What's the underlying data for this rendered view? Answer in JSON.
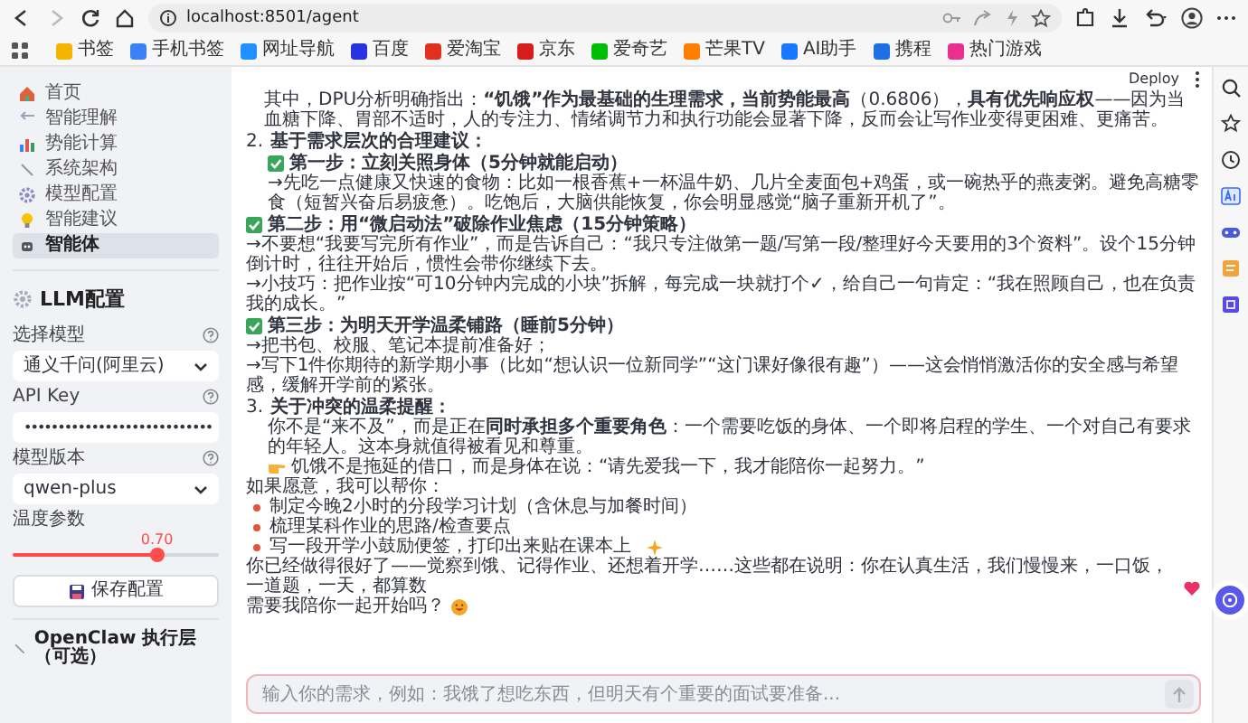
{
  "browser": {
    "url": "localhost:8501/agent",
    "bookmarks": [
      {
        "label": "书签",
        "color": "#f5b400"
      },
      {
        "label": "手机书签",
        "color": "#3b82f6"
      },
      {
        "label": "网址导航",
        "color": "#1e90ff"
      },
      {
        "label": "百度",
        "color": "#2932e1"
      },
      {
        "label": "爱淘宝",
        "color": "#e0301e"
      },
      {
        "label": "京东",
        "color": "#d71c1c"
      },
      {
        "label": "爱奇艺",
        "color": "#00be06"
      },
      {
        "label": "芒果TV",
        "color": "#ff7d00"
      },
      {
        "label": "AI助手",
        "color": "#1677ff"
      },
      {
        "label": "携程",
        "color": "#1f6fe5"
      },
      {
        "label": "热门游戏",
        "color": "#e8308c"
      }
    ]
  },
  "sidebar": {
    "nav": [
      {
        "label": "首页",
        "selected": false
      },
      {
        "label": "智能理解",
        "selected": false
      },
      {
        "label": "势能计算",
        "selected": false
      },
      {
        "label": "系统架构",
        "selected": false
      },
      {
        "label": "模型配置",
        "selected": false
      },
      {
        "label": "智能建议",
        "selected": false
      },
      {
        "label": "智能体",
        "selected": true
      }
    ],
    "llm": {
      "title": "LLM配置",
      "fields": [
        {
          "kind": "select",
          "label": "选择模型",
          "value": "通义千问(阿里云)"
        },
        {
          "kind": "password",
          "label": "API Key",
          "value": "••••••••••••••••••••••••••••"
        },
        {
          "kind": "select",
          "label": "模型版本",
          "value": "qwen-plus"
        }
      ],
      "slider": {
        "label": "温度参数",
        "reading": "0.70",
        "level": 0.7
      },
      "save_button": "保存配置"
    },
    "section_title": "OpenClaw 执行层（可选）"
  },
  "main": {
    "deploy": "Deploy",
    "blocks": [
      {
        "kind": "indented",
        "text": "其中，DPU分析明确指出：**“饥饿”作为最基础的生理需求，当前势能最高**（0.6806），**具有优先响应权**——因为当血糖下降、胃部不适时，人的专注力、情绪调节力和执行功能会显著下降，反而会让写作业变得更困难、更痛苦。"
      },
      {
        "kind": "section",
        "number": "2.",
        "title": "基于需求层次的合理建议：",
        "children": [
          {
            "kind": "step",
            "title": "第一步：立刻关照身体（5分钟就能启动）",
            "lines": [
              "→先吃一点健康又快速的食物：比如一根香蕉+一杯温牛奶、几片全麦面包+鸡蛋，或一碗热乎的燕麦粥。避免高糖零食（短暂兴奋后易疲惫）。吃饱后，大脑供能恢复，你会明显感觉“脑子重新开机了”。"
            ]
          }
        ]
      },
      {
        "kind": "step",
        "title": "第二步：用“微启动法”破除作业焦虑（15分钟策略）",
        "lines": [
          "→不要想“我要写完所有作业”，而是告诉自己：“我只专注做第一题/写第一段/整理好今天要用的3个资料”。设个15分钟倒计时，往往开始后，惯性会带你继续下去。",
          "→小技巧：把作业按“可10分钟内完成的小块”拆解，每完成一块就打个✓，给自己一句肯定：“我在照顾自己，也在负责我的成长。”"
        ]
      },
      {
        "kind": "step",
        "title": "第三步：为明天开学温柔铺路（睡前5分钟）",
        "lines": [
          "→把书包、校服、笔记本提前准备好；",
          "→写下1件你期待的新学期小事（比如“想认识一位新同学”“这门课好像很有趣”）——这会悄悄激活你的安全感与希望感，缓解开学前的紧张。"
        ]
      },
      {
        "kind": "section",
        "number": "3.",
        "title": "关于冲突的温柔提醒：",
        "children": [
          {
            "kind": "para",
            "text": "你不是“来不及”，而是正在**同时承担多个重要角色**：一个需要吃饭的身体、一个即将启程的学生、一个对自己有要求的年轻人。这本身就值得被看见和尊重。"
          },
          {
            "kind": "pointer",
            "text": "饥饿不是拖延的借口，而是身体在说：“请先爱我一下，我才能陪你一起努力。”"
          }
        ]
      },
      {
        "kind": "para",
        "text": "如果愿意，我可以帮你："
      },
      {
        "kind": "bullets",
        "items": [
          {
            "kind": "plain",
            "text": "制定今晚2小时的分段学习计划（含休息与加餐时间）"
          },
          {
            "kind": "plain",
            "text": "梳理某科作业的思路/检查要点"
          },
          {
            "kind": "sparkle",
            "text": "写一段开学小鼓励便签，打印出来贴在课本上"
          }
        ]
      },
      {
        "kind": "closing",
        "text": "你已经做得很好了——觉察到饿、记得作业、还想着开学……这些都在说明：你在认真生活，我们慢慢来，一口饭，一道题，一天，都算数"
      },
      {
        "kind": "question",
        "text": "需要我陪你一起开始吗？"
      }
    ],
    "input": {
      "placeholder": "输入你的需求，例如：我饿了想吃东西，但明天有个重要的面试要准备..."
    }
  }
}
